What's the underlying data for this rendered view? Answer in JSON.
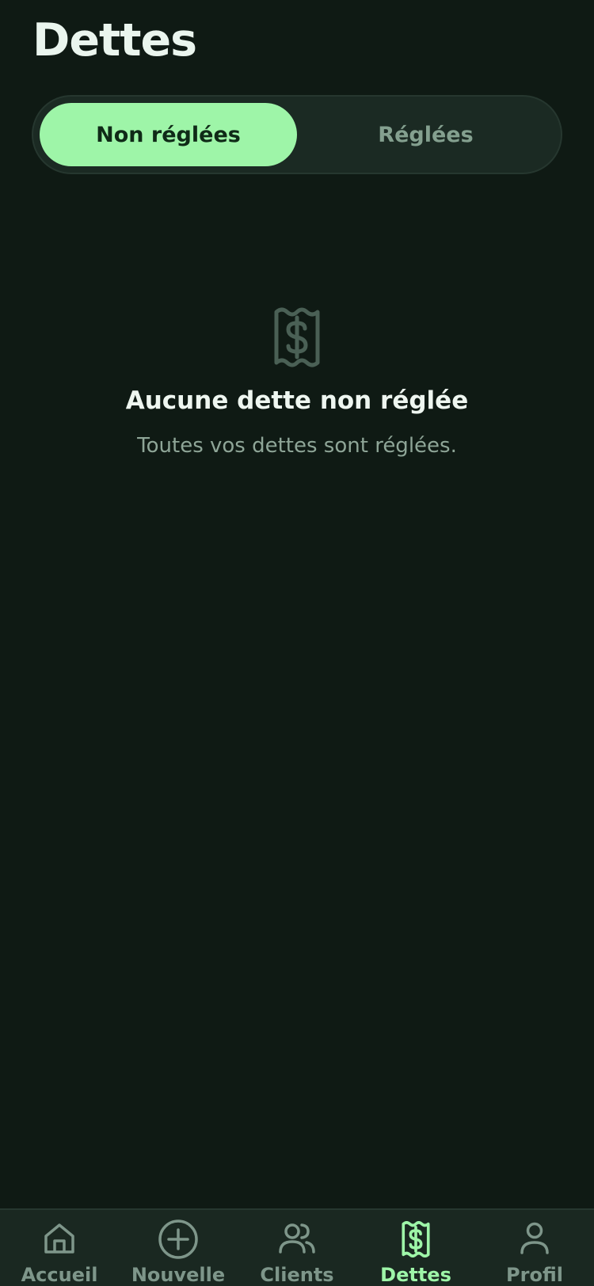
{
  "header": {
    "title": "Dettes"
  },
  "segments": {
    "unsettled_label": "Non réglées",
    "settled_label": "Réglées",
    "active": "unsettled"
  },
  "empty_state": {
    "icon": "receipt-dollar-icon",
    "title": "Aucune dette non réglée",
    "subtitle": "Toutes vos dettes sont réglées."
  },
  "bottom_nav": {
    "items": [
      {
        "label": "Accueil",
        "icon": "home-icon"
      },
      {
        "label": "Nouvelle",
        "icon": "plus-circle-icon"
      },
      {
        "label": "Clients",
        "icon": "users-icon"
      },
      {
        "label": "Dettes",
        "icon": "receipt-dollar-icon",
        "active": true
      },
      {
        "label": "Profil",
        "icon": "user-icon"
      }
    ]
  },
  "colors": {
    "background": "#0f1a14",
    "accent": "#9ef5a8",
    "muted": "#7e968a"
  }
}
